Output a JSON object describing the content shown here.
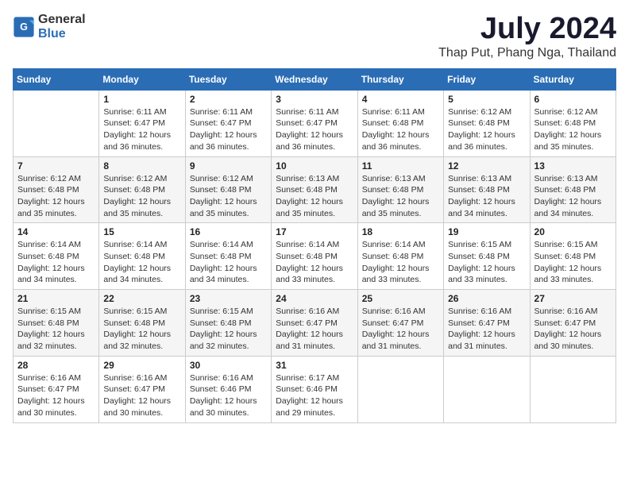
{
  "header": {
    "logo_general": "General",
    "logo_blue": "Blue",
    "month_title": "July 2024",
    "location": "Thap Put, Phang Nga, Thailand"
  },
  "calendar": {
    "days_of_week": [
      "Sunday",
      "Monday",
      "Tuesday",
      "Wednesday",
      "Thursday",
      "Friday",
      "Saturday"
    ],
    "weeks": [
      [
        {
          "day": "",
          "lines": []
        },
        {
          "day": "1",
          "lines": [
            "Sunrise: 6:11 AM",
            "Sunset: 6:47 PM",
            "Daylight: 12 hours",
            "and 36 minutes."
          ]
        },
        {
          "day": "2",
          "lines": [
            "Sunrise: 6:11 AM",
            "Sunset: 6:47 PM",
            "Daylight: 12 hours",
            "and 36 minutes."
          ]
        },
        {
          "day": "3",
          "lines": [
            "Sunrise: 6:11 AM",
            "Sunset: 6:47 PM",
            "Daylight: 12 hours",
            "and 36 minutes."
          ]
        },
        {
          "day": "4",
          "lines": [
            "Sunrise: 6:11 AM",
            "Sunset: 6:48 PM",
            "Daylight: 12 hours",
            "and 36 minutes."
          ]
        },
        {
          "day": "5",
          "lines": [
            "Sunrise: 6:12 AM",
            "Sunset: 6:48 PM",
            "Daylight: 12 hours",
            "and 36 minutes."
          ]
        },
        {
          "day": "6",
          "lines": [
            "Sunrise: 6:12 AM",
            "Sunset: 6:48 PM",
            "Daylight: 12 hours",
            "and 35 minutes."
          ]
        }
      ],
      [
        {
          "day": "7",
          "lines": [
            "Sunrise: 6:12 AM",
            "Sunset: 6:48 PM",
            "Daylight: 12 hours",
            "and 35 minutes."
          ]
        },
        {
          "day": "8",
          "lines": [
            "Sunrise: 6:12 AM",
            "Sunset: 6:48 PM",
            "Daylight: 12 hours",
            "and 35 minutes."
          ]
        },
        {
          "day": "9",
          "lines": [
            "Sunrise: 6:12 AM",
            "Sunset: 6:48 PM",
            "Daylight: 12 hours",
            "and 35 minutes."
          ]
        },
        {
          "day": "10",
          "lines": [
            "Sunrise: 6:13 AM",
            "Sunset: 6:48 PM",
            "Daylight: 12 hours",
            "and 35 minutes."
          ]
        },
        {
          "day": "11",
          "lines": [
            "Sunrise: 6:13 AM",
            "Sunset: 6:48 PM",
            "Daylight: 12 hours",
            "and 35 minutes."
          ]
        },
        {
          "day": "12",
          "lines": [
            "Sunrise: 6:13 AM",
            "Sunset: 6:48 PM",
            "Daylight: 12 hours",
            "and 34 minutes."
          ]
        },
        {
          "day": "13",
          "lines": [
            "Sunrise: 6:13 AM",
            "Sunset: 6:48 PM",
            "Daylight: 12 hours",
            "and 34 minutes."
          ]
        }
      ],
      [
        {
          "day": "14",
          "lines": [
            "Sunrise: 6:14 AM",
            "Sunset: 6:48 PM",
            "Daylight: 12 hours",
            "and 34 minutes."
          ]
        },
        {
          "day": "15",
          "lines": [
            "Sunrise: 6:14 AM",
            "Sunset: 6:48 PM",
            "Daylight: 12 hours",
            "and 34 minutes."
          ]
        },
        {
          "day": "16",
          "lines": [
            "Sunrise: 6:14 AM",
            "Sunset: 6:48 PM",
            "Daylight: 12 hours",
            "and 34 minutes."
          ]
        },
        {
          "day": "17",
          "lines": [
            "Sunrise: 6:14 AM",
            "Sunset: 6:48 PM",
            "Daylight: 12 hours",
            "and 33 minutes."
          ]
        },
        {
          "day": "18",
          "lines": [
            "Sunrise: 6:14 AM",
            "Sunset: 6:48 PM",
            "Daylight: 12 hours",
            "and 33 minutes."
          ]
        },
        {
          "day": "19",
          "lines": [
            "Sunrise: 6:15 AM",
            "Sunset: 6:48 PM",
            "Daylight: 12 hours",
            "and 33 minutes."
          ]
        },
        {
          "day": "20",
          "lines": [
            "Sunrise: 6:15 AM",
            "Sunset: 6:48 PM",
            "Daylight: 12 hours",
            "and 33 minutes."
          ]
        }
      ],
      [
        {
          "day": "21",
          "lines": [
            "Sunrise: 6:15 AM",
            "Sunset: 6:48 PM",
            "Daylight: 12 hours",
            "and 32 minutes."
          ]
        },
        {
          "day": "22",
          "lines": [
            "Sunrise: 6:15 AM",
            "Sunset: 6:48 PM",
            "Daylight: 12 hours",
            "and 32 minutes."
          ]
        },
        {
          "day": "23",
          "lines": [
            "Sunrise: 6:15 AM",
            "Sunset: 6:48 PM",
            "Daylight: 12 hours",
            "and 32 minutes."
          ]
        },
        {
          "day": "24",
          "lines": [
            "Sunrise: 6:16 AM",
            "Sunset: 6:47 PM",
            "Daylight: 12 hours",
            "and 31 minutes."
          ]
        },
        {
          "day": "25",
          "lines": [
            "Sunrise: 6:16 AM",
            "Sunset: 6:47 PM",
            "Daylight: 12 hours",
            "and 31 minutes."
          ]
        },
        {
          "day": "26",
          "lines": [
            "Sunrise: 6:16 AM",
            "Sunset: 6:47 PM",
            "Daylight: 12 hours",
            "and 31 minutes."
          ]
        },
        {
          "day": "27",
          "lines": [
            "Sunrise: 6:16 AM",
            "Sunset: 6:47 PM",
            "Daylight: 12 hours",
            "and 30 minutes."
          ]
        }
      ],
      [
        {
          "day": "28",
          "lines": [
            "Sunrise: 6:16 AM",
            "Sunset: 6:47 PM",
            "Daylight: 12 hours",
            "and 30 minutes."
          ]
        },
        {
          "day": "29",
          "lines": [
            "Sunrise: 6:16 AM",
            "Sunset: 6:47 PM",
            "Daylight: 12 hours",
            "and 30 minutes."
          ]
        },
        {
          "day": "30",
          "lines": [
            "Sunrise: 6:16 AM",
            "Sunset: 6:46 PM",
            "Daylight: 12 hours",
            "and 30 minutes."
          ]
        },
        {
          "day": "31",
          "lines": [
            "Sunrise: 6:17 AM",
            "Sunset: 6:46 PM",
            "Daylight: 12 hours",
            "and 29 minutes."
          ]
        },
        {
          "day": "",
          "lines": []
        },
        {
          "day": "",
          "lines": []
        },
        {
          "day": "",
          "lines": []
        }
      ]
    ]
  }
}
